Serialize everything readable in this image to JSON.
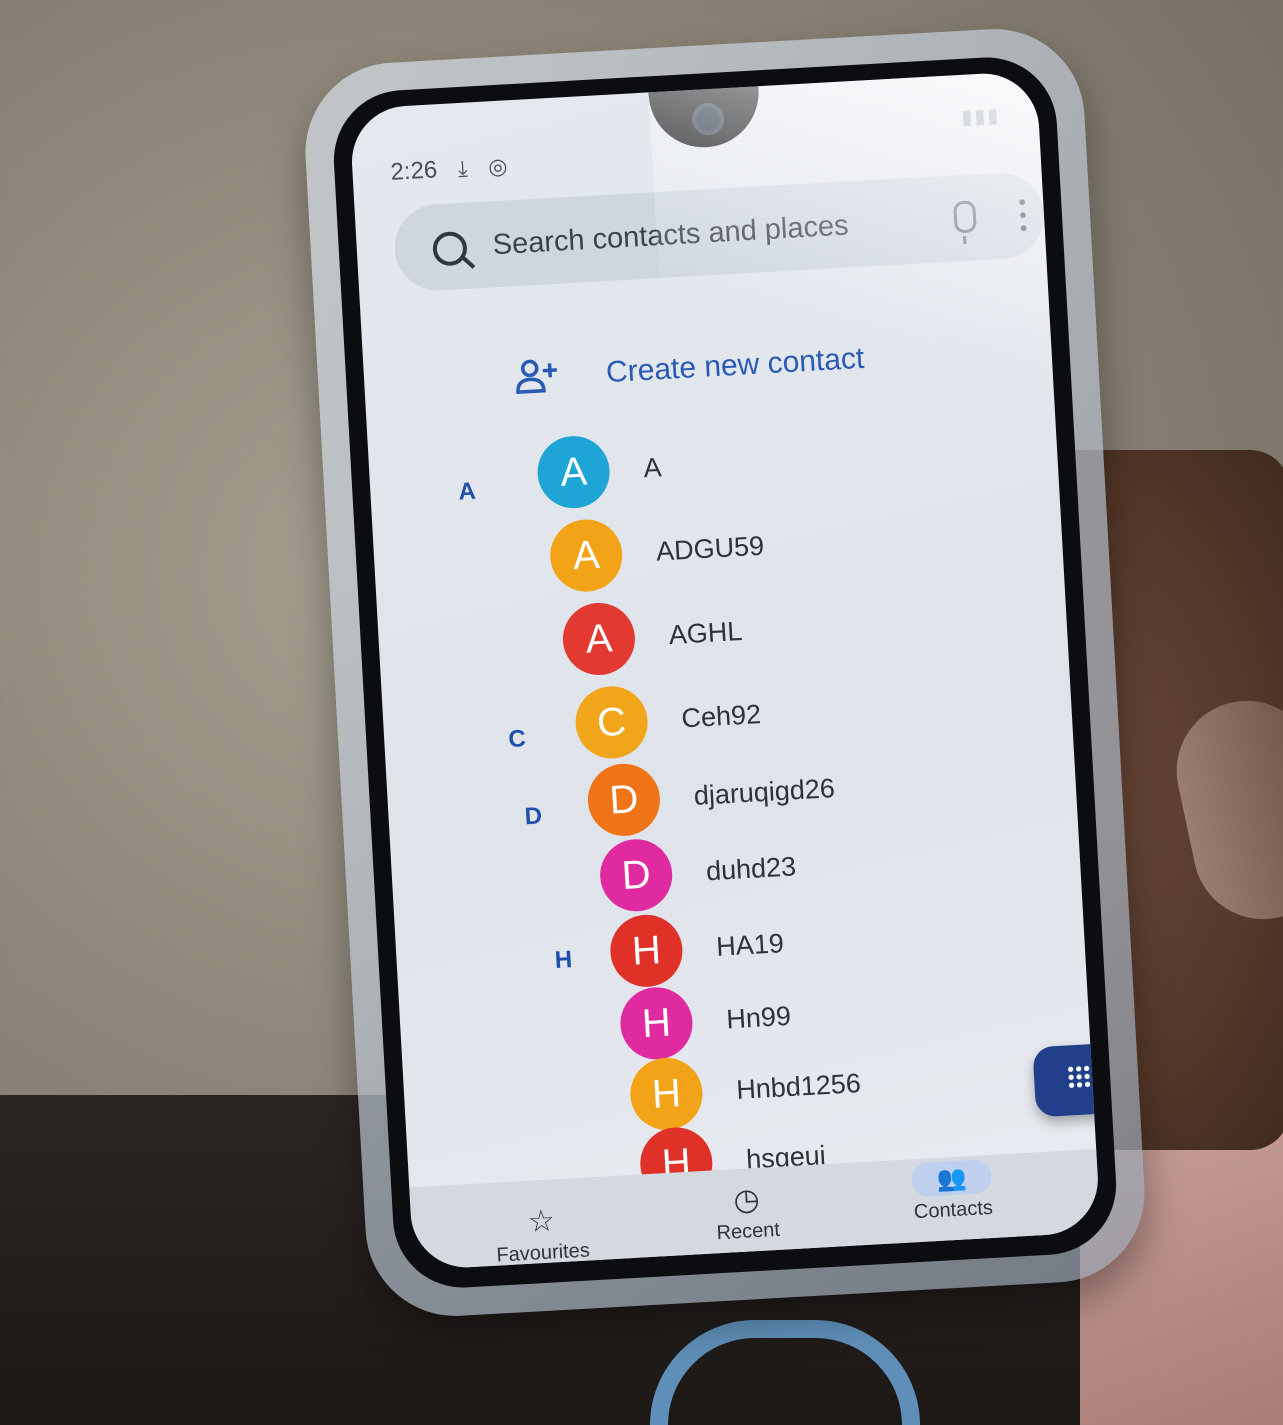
{
  "status_bar": {
    "time": "2:26"
  },
  "search": {
    "placeholder": "Search contacts and places"
  },
  "create_contact": {
    "label": "Create new contact"
  },
  "sections": {
    "a": "A",
    "c": "C",
    "d": "D",
    "h": "H"
  },
  "contacts": [
    {
      "initial": "A",
      "name": "A",
      "color": "#1ea5d6"
    },
    {
      "initial": "A",
      "name": "ADGU59",
      "color": "#f2a317"
    },
    {
      "initial": "A",
      "name": "AGHL",
      "color": "#e23a30"
    },
    {
      "initial": "C",
      "name": "Ceh92",
      "color": "#f0a51a"
    },
    {
      "initial": "D",
      "name": "djaruqigd26",
      "color": "#ef7418"
    },
    {
      "initial": "D",
      "name": "duhd23",
      "color": "#e02aa0"
    },
    {
      "initial": "H",
      "name": "HA19",
      "color": "#df3128"
    },
    {
      "initial": "H",
      "name": "Hn99",
      "color": "#e02aa0"
    },
    {
      "initial": "H",
      "name": "Hnbd1256",
      "color": "#f2a317"
    },
    {
      "initial": "H",
      "name": "hsgeui",
      "color": "#df3128"
    }
  ],
  "bottom_nav": {
    "favourites": "Favourites",
    "recent": "Recent",
    "contacts": "Contacts"
  },
  "icons": {
    "search": "search-icon",
    "mic": "mic-icon",
    "more": "more-vert-icon",
    "add_person": "person-add-icon",
    "dialpad": "dialpad-icon",
    "star": "star-icon",
    "clock": "clock-icon",
    "people": "people-icon"
  }
}
